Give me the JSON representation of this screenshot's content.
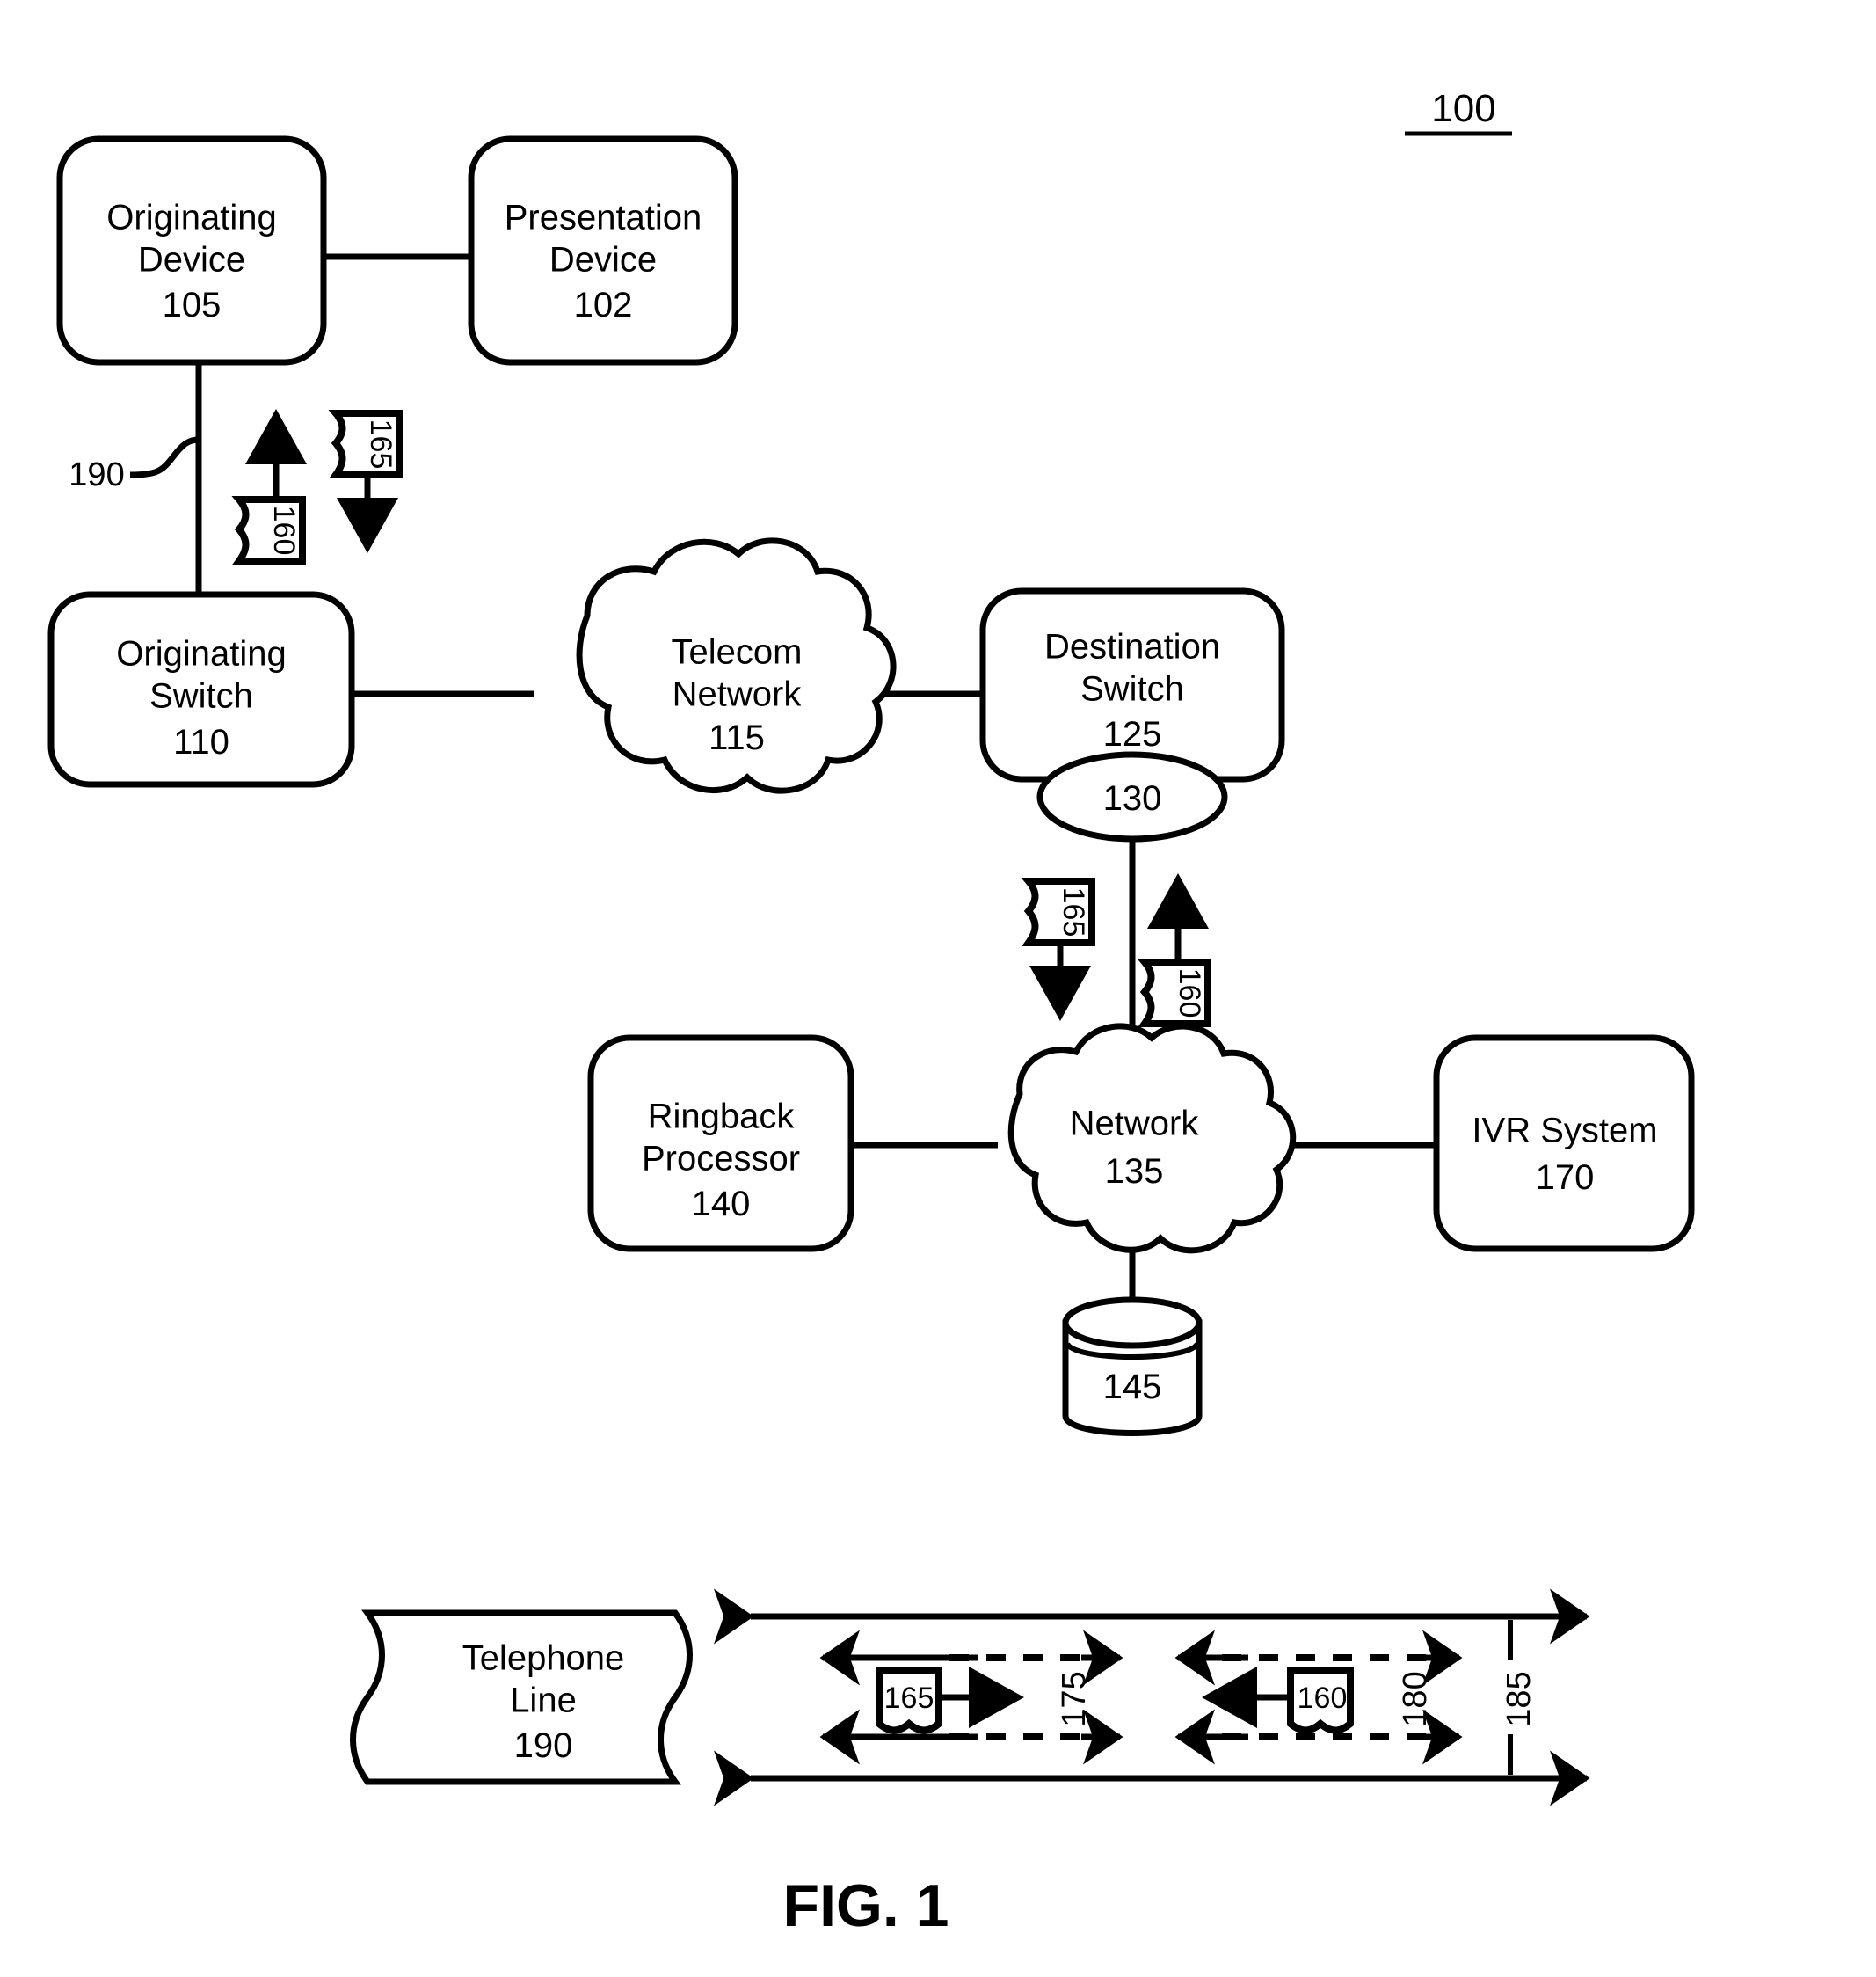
{
  "figure": {
    "number_label": "100",
    "caption": "FIG. 1"
  },
  "nodes": {
    "originating_device": {
      "line1": "Originating",
      "line2": "Device",
      "ref": "105"
    },
    "presentation_device": {
      "line1": "Presentation",
      "line2": "Device",
      "ref": "102"
    },
    "originating_switch": {
      "line1": "Originating",
      "line2": "Switch",
      "ref": "110"
    },
    "telecom_network": {
      "line1": "Telecom",
      "line2": "Network",
      "ref": "115"
    },
    "destination_switch": {
      "line1": "Destination",
      "line2": "Switch",
      "ref": "125"
    },
    "trunk_group": {
      "ref": "130"
    },
    "ringback_processor": {
      "line1": "Ringback",
      "line2": "Processor",
      "ref": "140"
    },
    "network": {
      "line1": "Network",
      "ref": "135"
    },
    "ivr_system": {
      "line1": "IVR System",
      "ref": "170"
    },
    "database": {
      "ref": "145"
    },
    "telephone_line": {
      "line1": "Telephone",
      "line2": "Line",
      "ref": "190"
    }
  },
  "signals": {
    "upstream_packet": "160",
    "downstream_packet": "165",
    "line_190_label": "190",
    "forward_channel": "175",
    "reverse_channel": "180",
    "full_line": "185"
  },
  "detail_panel": {
    "packet_forward": "165",
    "packet_reverse": "160",
    "channel_forward_ref": "175",
    "channel_reverse_ref": "180",
    "line_ref": "185"
  }
}
